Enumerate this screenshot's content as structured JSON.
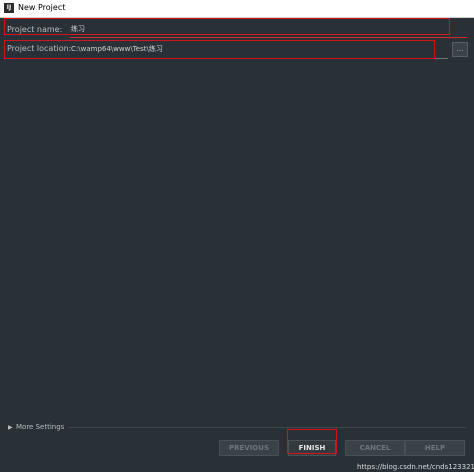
{
  "window": {
    "title": "New Project",
    "icon": "intellij-app-icon"
  },
  "form": {
    "project_name_label": "Project name:",
    "project_name_value": "练习",
    "project_location_label": "Project location:",
    "project_location_value": "C:\\wamp64\\www\\Test\\练习",
    "browse_label": "..."
  },
  "more_settings": {
    "label": "More Settings",
    "icon": "chevron-right-icon"
  },
  "footer": {
    "previous_label": "PREVIOUS",
    "finish_label": "FINISH",
    "cancel_label": "CANCEL",
    "help_label": "HELP"
  },
  "watermark": "https://blog.csdn.net/cnds123321",
  "colors": {
    "background": "#2a3136",
    "highlight": "#d2141b",
    "error_underline": "#c9302c",
    "text": "#bbbbbb"
  }
}
